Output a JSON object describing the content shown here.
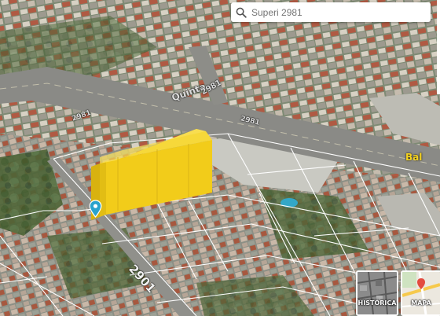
{
  "search": {
    "placeholder": "Superi 2981",
    "value": ""
  },
  "streets": [
    {
      "id": "quinta",
      "text": "Quinta"
    },
    {
      "id": "2981-upper",
      "text": "2981"
    },
    {
      "id": "2981-left",
      "text": "2981"
    },
    {
      "id": "2981-mid",
      "text": "2981"
    },
    {
      "id": "2901-main",
      "text": "2901"
    },
    {
      "id": "bal",
      "text": "Bal"
    }
  ],
  "tiles": {
    "historic_label": "HISTÓRICA",
    "map_label": "MAPA"
  },
  "colors": {
    "building": "#f2cc1a",
    "pin": "#2aa3cc",
    "parcel_line": "#ffffff"
  }
}
